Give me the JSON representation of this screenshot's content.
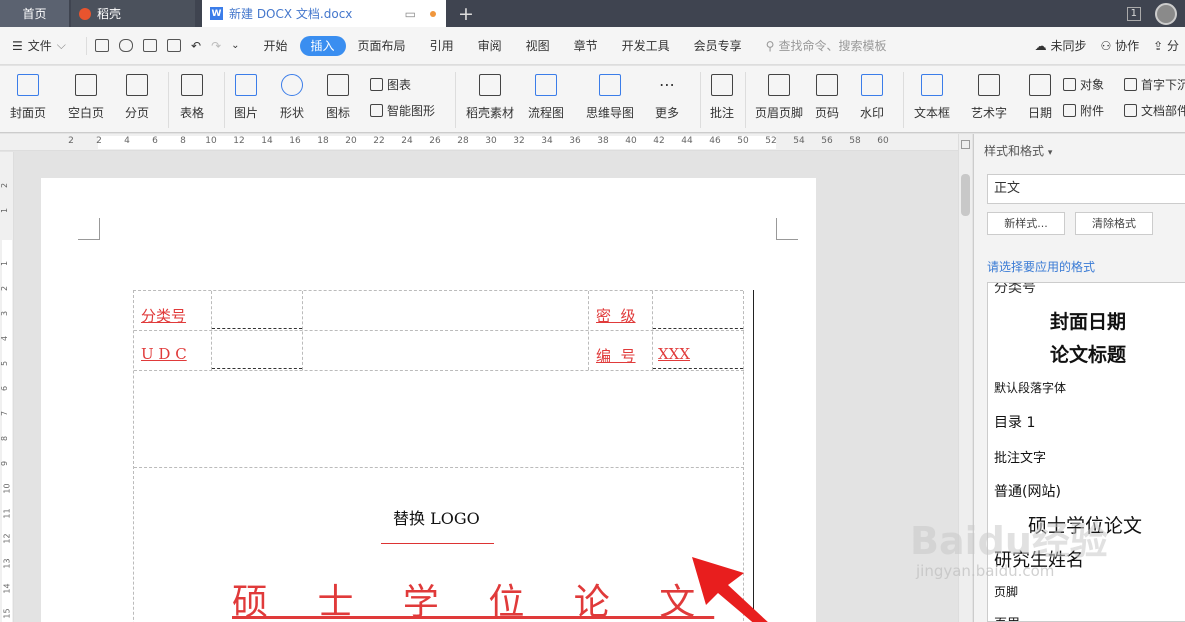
{
  "tabs": {
    "home": "首页",
    "wps_cloud": "稻壳",
    "document": "新建 DOCX 文档.docx",
    "window_count": "1"
  },
  "menu": {
    "file": "文件",
    "tabs": [
      "开始",
      "插入",
      "页面布局",
      "引用",
      "审阅",
      "视图",
      "章节",
      "开发工具",
      "会员专享"
    ],
    "active_tab": "插入",
    "search_placeholder": "查找命令、搜索模板",
    "right": [
      "未同步",
      "协作",
      "分"
    ]
  },
  "toolbar": {
    "cover_page": "封面页",
    "blank_page": "空白页",
    "page_break": "分页",
    "table": "表格",
    "picture": "图片",
    "shape": "形状",
    "icon": "图标",
    "chart": "图表",
    "smart_art": "智能图形",
    "docer_material": "稻壳素材",
    "flowchart": "流程图",
    "mind_map": "思维导图",
    "more": "更多",
    "comment": "批注",
    "header_footer": "页眉页脚",
    "page_number": "页码",
    "watermark": "水印",
    "text_box": "文本框",
    "word_art": "艺术字",
    "date": "日期",
    "object": "对象",
    "attachment": "附件",
    "drop_cap": "首字下沉",
    "doc_parts": "文档部件"
  },
  "ruler": {
    "marks": [
      "2",
      "2",
      "4",
      "6",
      "8",
      "10",
      "12",
      "14",
      "16",
      "18",
      "20",
      "22",
      "24",
      "26",
      "28",
      "30",
      "32",
      "34",
      "36",
      "38",
      "40",
      "42",
      "44",
      "46",
      "50",
      "52",
      "54",
      "56",
      "58",
      "60"
    ],
    "vmarks": [
      "2",
      "1",
      "1",
      "2",
      "3",
      "4",
      "5",
      "6",
      "7",
      "8",
      "9",
      "10",
      "11",
      "12",
      "13",
      "14",
      "15"
    ]
  },
  "document": {
    "classification_label": "分类号",
    "secret_label": "密  级",
    "udc_label": "U D C",
    "number_label": "编  号",
    "number_value": "XXX",
    "logo_text": "替换 LOGO",
    "thesis_title": "硕 士 学 位 论 文"
  },
  "side_panel": {
    "title": "样式和格式",
    "current_style": "正文",
    "new_style_button": "新样式...",
    "clear_format_button": "清除格式",
    "prompt": "请选择要应用的格式",
    "styles": [
      "分类号",
      "封面日期",
      "论文标题",
      "默认段落字体",
      "目录 1",
      "批注文字",
      "普通(网站)",
      "硕士学位论文",
      "研究生姓名",
      "页脚",
      "页眉"
    ]
  },
  "watermark": {
    "brand": "Baidu经验",
    "url": "jingyan.baidu.com"
  },
  "colors": {
    "accent": "#3a8ef0",
    "red_text": "#e03a3a",
    "arrow": "#e81e1e",
    "tab_bar": "#3f4450"
  }
}
